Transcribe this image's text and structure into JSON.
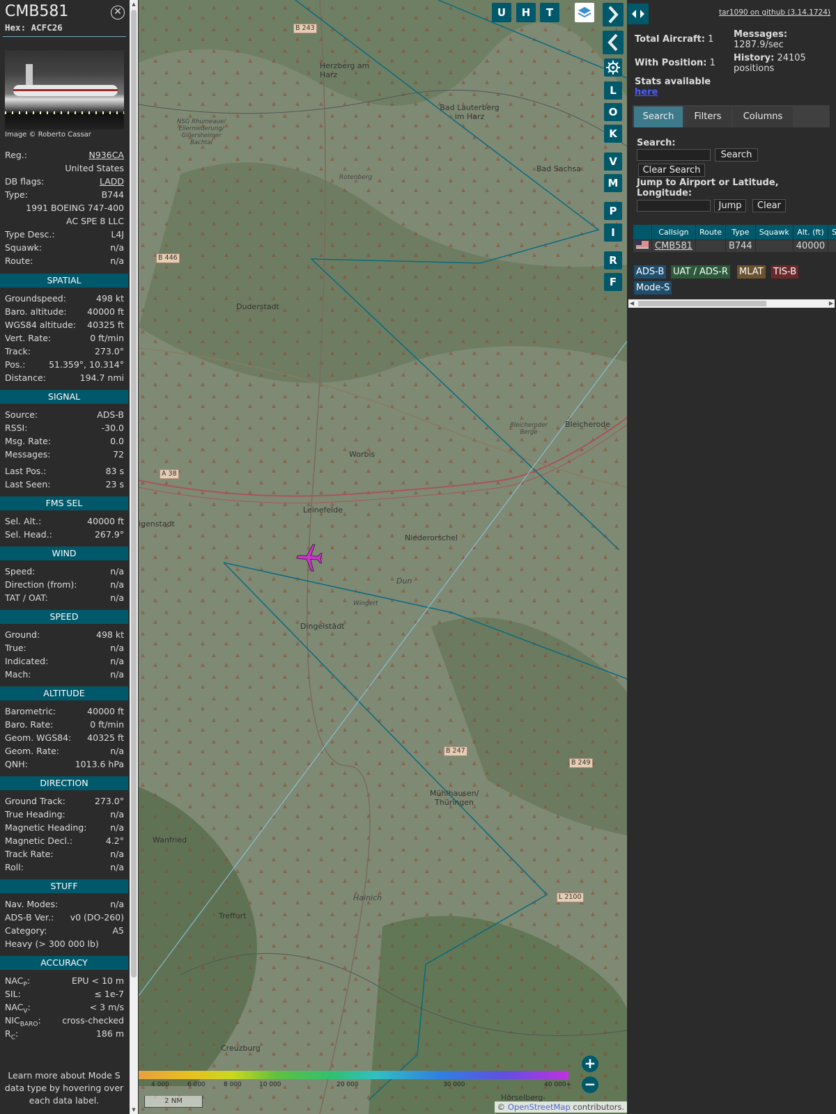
{
  "sidebar": {
    "callsign": "CMB581",
    "hex_label": "Hex: ACFC26",
    "close_glyph": "✕",
    "photo_credit": "Image © Roberto Cassar",
    "top_rows": [
      {
        "label": "Reg.:",
        "value": "N936CA",
        "link": true
      },
      {
        "label": "",
        "value": "United States"
      },
      {
        "label": "DB flags:",
        "value": "LADD",
        "link": true
      },
      {
        "label": "Type:",
        "value": "B744"
      },
      {
        "label": "",
        "value": "1991 BOEING 747-400"
      },
      {
        "label": "",
        "value": "AC SPE 8 LLC"
      },
      {
        "label": "Type Desc.:",
        "value": "L4J"
      },
      {
        "label": "Squawk:",
        "value": "n/a"
      },
      {
        "label": "Route:",
        "value": "n/a"
      }
    ],
    "sections": [
      {
        "title": "SPATIAL",
        "rows": [
          {
            "label": "Groundspeed:",
            "value": "498 kt"
          },
          {
            "label": "Baro. altitude:",
            "value": "40000 ft"
          },
          {
            "label": "WGS84 altitude:",
            "value": "40325 ft"
          },
          {
            "label": "Vert. Rate:",
            "value": "0 ft/min"
          },
          {
            "label": "Track:",
            "value": "273.0°"
          },
          {
            "label": "Pos.:",
            "value": "51.359°, 10.314°"
          },
          {
            "label": "Distance:",
            "value": "194.7 nmi"
          }
        ]
      },
      {
        "title": "SIGNAL",
        "rows": [
          {
            "label": "Source:",
            "value": "ADS-B"
          },
          {
            "label": "RSSI:",
            "value": "-30.0"
          },
          {
            "label": "Msg. Rate:",
            "value": "0.0"
          },
          {
            "label": "Messages:",
            "value": "72"
          },
          {
            "label": "Last Pos.:",
            "value": "83 s"
          },
          {
            "label": "Last Seen:",
            "value": "23 s"
          }
        ]
      },
      {
        "title": "FMS SEL",
        "rows": [
          {
            "label": "Sel. Alt.:",
            "value": "40000 ft"
          },
          {
            "label": "Sel. Head.:",
            "value": "267.9°"
          }
        ]
      },
      {
        "title": "WIND",
        "rows": [
          {
            "label": "Speed:",
            "value": "n/a"
          },
          {
            "label": "Direction (from):",
            "value": "n/a"
          },
          {
            "label": "TAT / OAT:",
            "value": "n/a"
          }
        ]
      },
      {
        "title": "SPEED",
        "rows": [
          {
            "label": "Ground:",
            "value": "498 kt"
          },
          {
            "label": "True:",
            "value": "n/a"
          },
          {
            "label": "Indicated:",
            "value": "n/a"
          },
          {
            "label": "Mach:",
            "value": "n/a"
          }
        ]
      },
      {
        "title": "ALTITUDE",
        "rows": [
          {
            "label": "Barometric:",
            "value": "40000 ft"
          },
          {
            "label": "Baro. Rate:",
            "value": "0 ft/min"
          },
          {
            "label": "Geom. WGS84:",
            "value": "40325 ft"
          },
          {
            "label": "Geom. Rate:",
            "value": "n/a"
          },
          {
            "label": "QNH:",
            "value": "1013.6 hPa"
          }
        ]
      },
      {
        "title": "DIRECTION",
        "rows": [
          {
            "label": "Ground Track:",
            "value": "273.0°"
          },
          {
            "label": "True Heading:",
            "value": "n/a"
          },
          {
            "label": "Magnetic Heading:",
            "value": "n/a"
          },
          {
            "label": "Magnetic Decl.:",
            "value": "4.2°"
          },
          {
            "label": "Track Rate:",
            "value": "n/a"
          },
          {
            "label": "Roll:",
            "value": "n/a"
          }
        ]
      },
      {
        "title": "STUFF",
        "rows": [
          {
            "label": "Nav. Modes:",
            "value": "n/a"
          },
          {
            "label": "ADS-B Ver.:",
            "value": "v0 (DO-260)"
          },
          {
            "label": "Category:",
            "value": "A5"
          },
          {
            "label": "Heavy (> 300 000 lb)",
            "value": ""
          }
        ]
      },
      {
        "title": "ACCURACY",
        "rows": [
          {
            "label": "NAC",
            "sub": "P",
            "value": "EPU < 10 m"
          },
          {
            "label": "SIL:",
            "value": "≤ 1e-7"
          },
          {
            "label": "NAC",
            "sub": "V",
            "value": "< 3 m/s"
          },
          {
            "label": "NIC",
            "sub": "BARO",
            "value": "cross-checked"
          },
          {
            "label": "R",
            "sub": "C",
            "value": "186 m"
          }
        ]
      }
    ],
    "learn_more": "Learn more about Mode S data type by hovering over each data label."
  },
  "map": {
    "buttons_top": [
      "U",
      "H",
      "T"
    ],
    "buttons_side": [
      "L",
      "O",
      "K",
      "V",
      "M",
      "P",
      "I",
      "R",
      "F"
    ],
    "icons": {
      "layers": "layers-icon",
      "expand": "chevron-right-icon",
      "collapse": "chevron-left-icon",
      "settings": "gear-icon",
      "toggle": "arrows-horizontal-icon"
    },
    "towns": [
      "Herzberg am Harz",
      "Bad Lauterberg im Harz",
      "Bad Sachsa",
      "NSG Rhumeaue/ Ellerniederung/ Gillersheimer Bachtal",
      "Rotenberg",
      "Duderstadt",
      "Bleicheroder Berge",
      "Bleicherode",
      "Worbis",
      "Leinefelde",
      "Niederorschel",
      "igenstadt",
      "Dun",
      "Wingert",
      "Dingelstädt",
      "Mühlhausen/ Thüringen",
      "Wanfried",
      "Hainich",
      "Treffurt",
      "Creuzburg",
      "Hörselberg-"
    ],
    "roads": [
      "B 243",
      "B 446",
      "A 38",
      "B 247",
      "B 249",
      "L 2100"
    ],
    "altitude_legend": [
      "4 000",
      "6 000",
      "8 000",
      "10 000",
      "20 000",
      "30 000",
      "40 000+"
    ],
    "scale": "2 NM",
    "attribution_prefix": "©",
    "attribution_link": "OpenStreetMap",
    "attribution_suffix": "contributors.",
    "zoom_in": "+",
    "zoom_out": "−"
  },
  "panel": {
    "github": "tar1090 on github (3.14.1724)",
    "total_aircraft_label": "Total Aircraft:",
    "total_aircraft": "1",
    "with_position_label": "With Position:",
    "with_position": "1",
    "messages_label": "Messages:",
    "messages_value": "1287.9/sec",
    "history_label": "History:",
    "history_value": "24105",
    "history_unit": "positions",
    "stats_label": "Stats available",
    "stats_link": "here",
    "tabs": [
      "Search",
      "Filters",
      "Columns"
    ],
    "search_label": "Search:",
    "search_button": "Search",
    "clear_search_button": "Clear Search",
    "jump_label": "Jump to Airport or Latitude, Longitude:",
    "jump_button": "Jump",
    "clear_button": "Clear",
    "table_headers": [
      "",
      "Callsign",
      "Route",
      "Type",
      "Squawk",
      "Alt. (ft)",
      "Spd."
    ],
    "table_rows": [
      {
        "flag": "us-flag-icon",
        "callsign": "CMB581",
        "route": "",
        "type": "B744",
        "squawk": "",
        "alt": "40000",
        "spd": ""
      }
    ],
    "source_badges": [
      {
        "label": "ADS-B",
        "color": "#1f4e6e"
      },
      {
        "label": "UAT / ADS-R",
        "color": "#2c5a3a"
      },
      {
        "label": "MLAT",
        "color": "#6b5330"
      },
      {
        "label": "TIS-B",
        "color": "#6b2a2a"
      },
      {
        "label": "Mode-S",
        "color": "#1f4e6e"
      }
    ]
  },
  "colors": {
    "accent": "#00596b",
    "tab_active": "#3d7a8c",
    "aircraft": "#cc33cc",
    "link": "#4a5cff"
  }
}
